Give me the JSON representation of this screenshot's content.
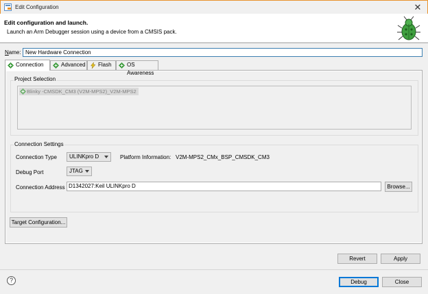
{
  "window": {
    "title": "Edit Configuration",
    "close_glyph": "✕"
  },
  "header": {
    "title": "Edit configuration and launch.",
    "description": "Launch an Arm Debugger session using a device from a CMSIS pack."
  },
  "name_field": {
    "label_prefix": "N",
    "label_rest": "ame:",
    "value": "New Hardware Connection"
  },
  "tabs": [
    {
      "label": "Connection",
      "icon": "connection-icon"
    },
    {
      "label": "Advanced",
      "icon": "advanced-icon"
    },
    {
      "label": "Flash",
      "icon": "flash-icon"
    },
    {
      "label": "OS Awareness",
      "icon": "os-awareness-icon"
    }
  ],
  "project_selection": {
    "title": "Project Selection",
    "item": "Blinky -CMSDK_CM3 (V2M-MPS2)_V2M-MPS2"
  },
  "connection_settings": {
    "title": "Connection Settings",
    "connection_type_label": "Connection Type",
    "connection_type_value": "ULINKpro D",
    "platform_info_label": "Platform Information:",
    "platform_info_value": "V2M-MPS2_CMx_BSP_CMSDK_CM3",
    "debug_port_label": "Debug Port",
    "debug_port_value": "JTAG",
    "connection_address_label": "Connection Address",
    "connection_address_value": "D1342027:Keil ULINKpro D",
    "browse_label": "Browse..."
  },
  "buttons": {
    "target_configuration": "Target Configuration...",
    "revert": "Revert",
    "apply": "Apply",
    "debug": "Debug",
    "close": "Close",
    "help": "?"
  },
  "colors": {
    "accent": "#e8922b",
    "focus": "#0078d7",
    "tab_icon_green": "#3a9a3a"
  }
}
